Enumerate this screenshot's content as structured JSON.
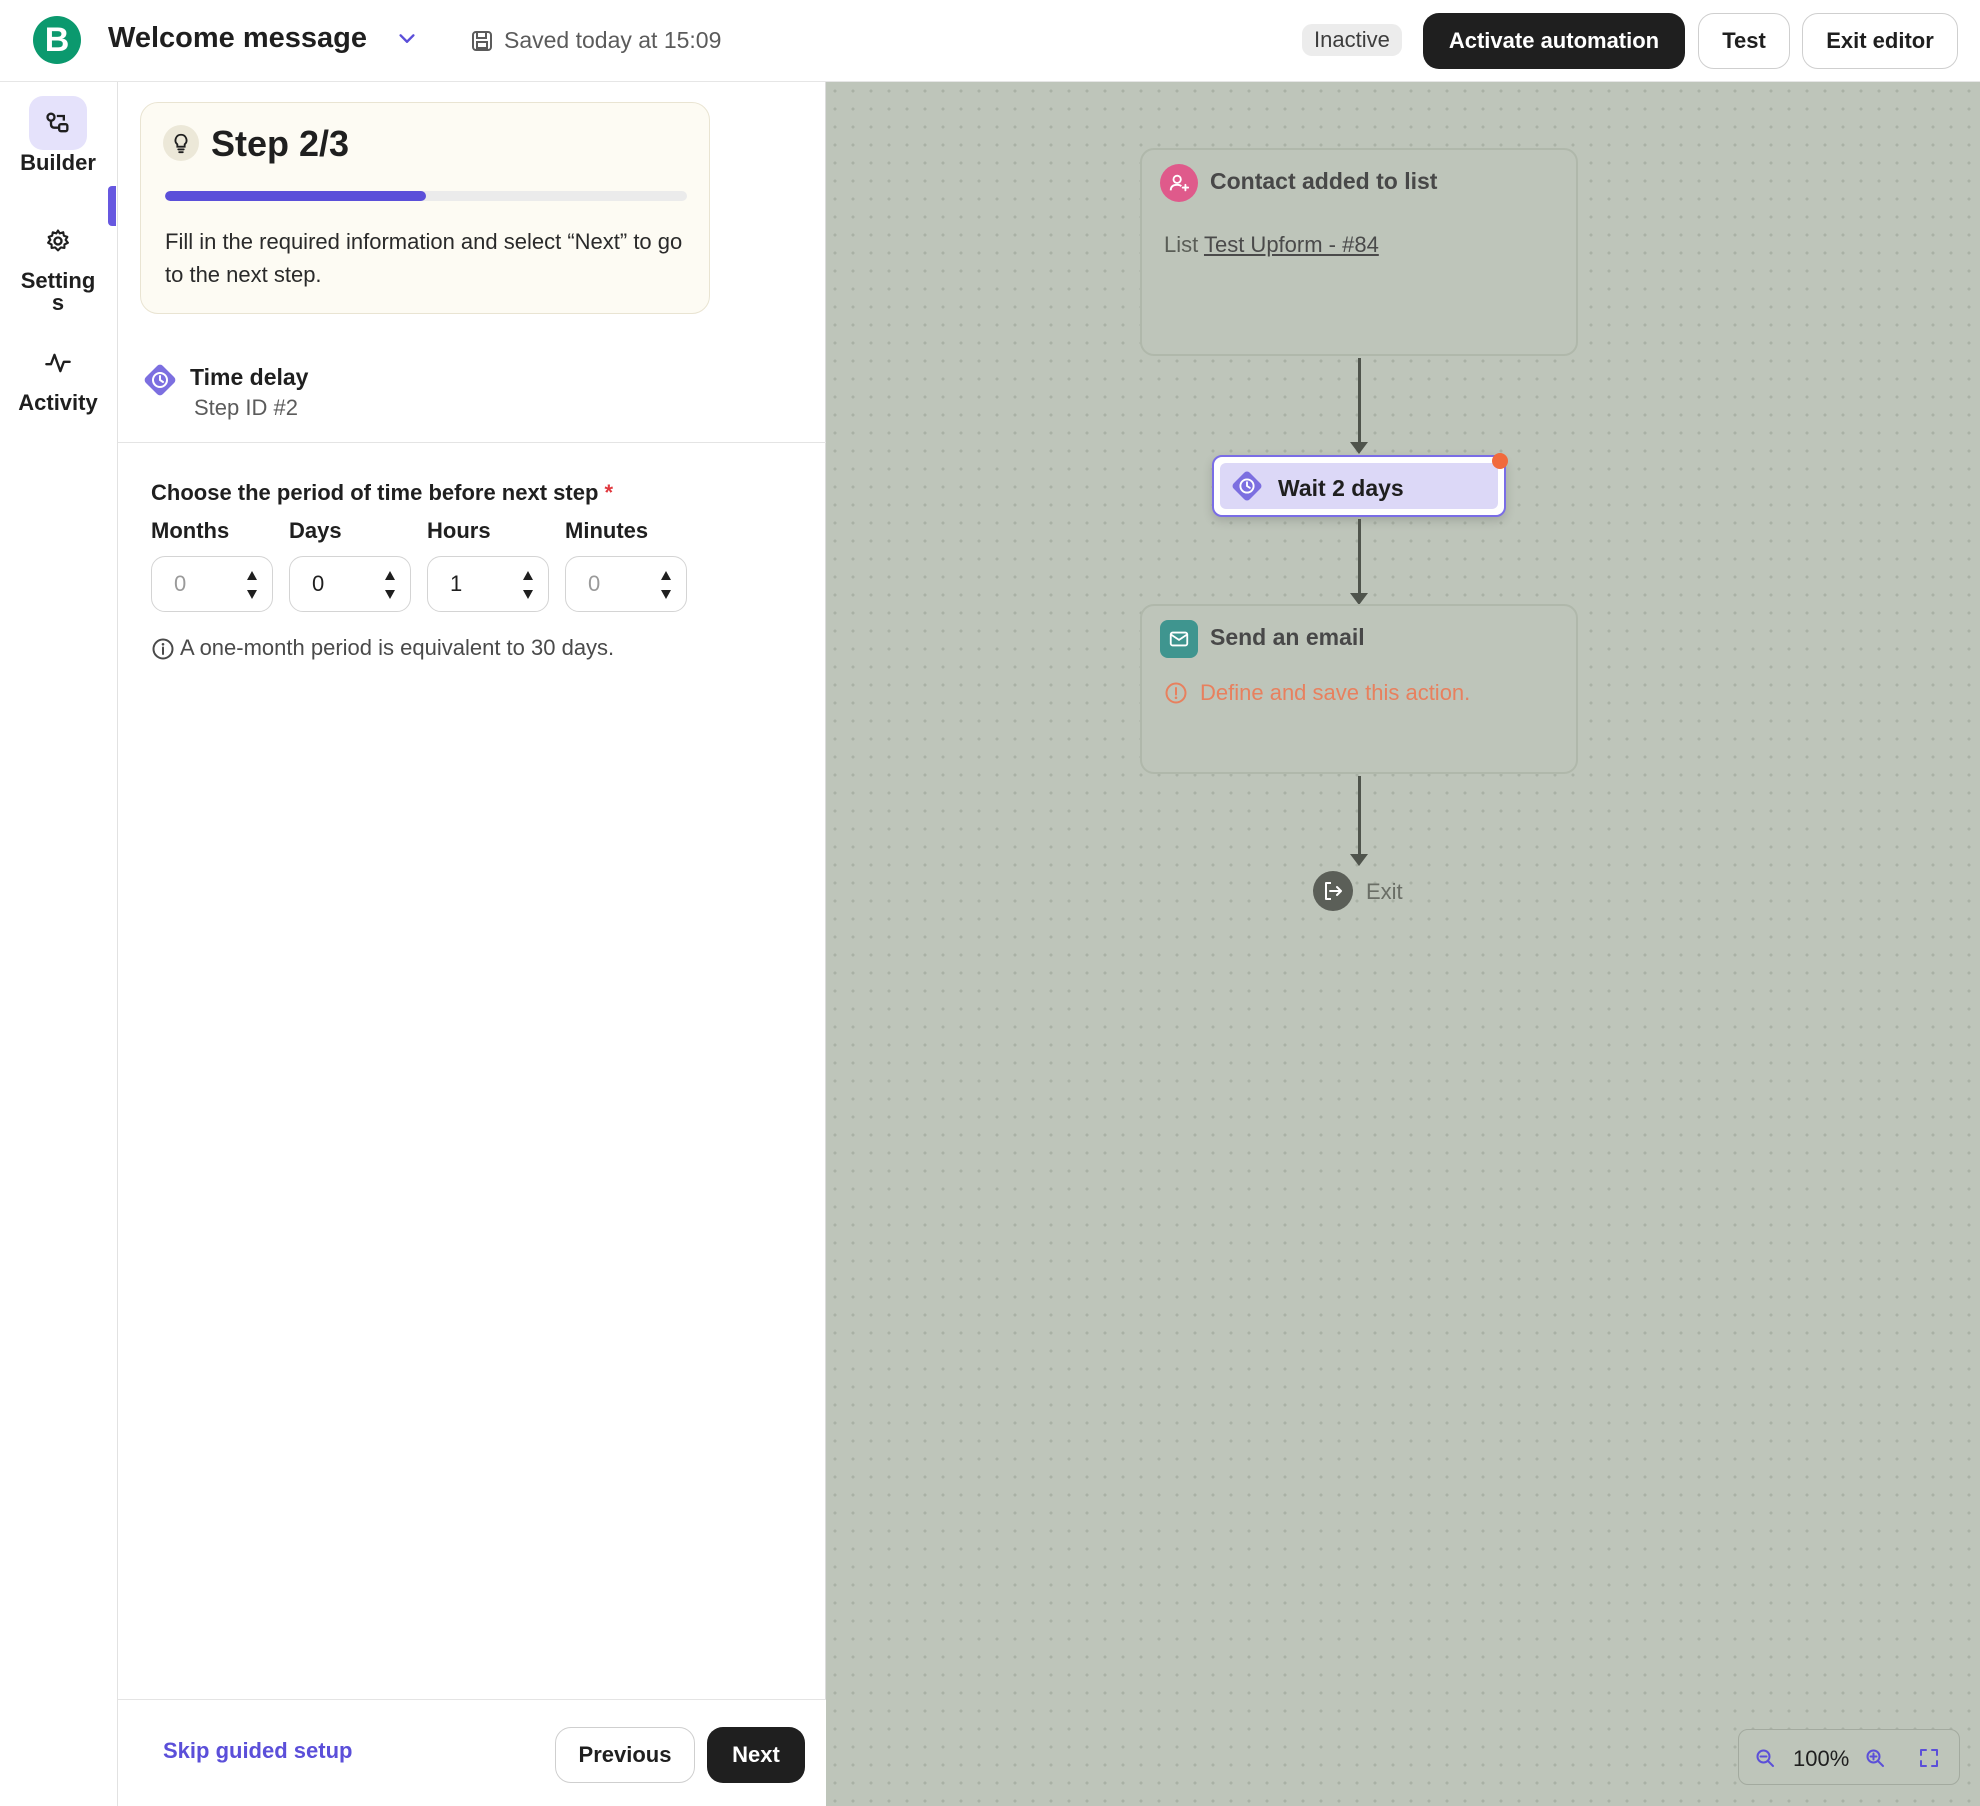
{
  "app": {
    "logo_letter": "B",
    "title": "Welcome message",
    "saved_status": "Saved today at 15:09",
    "status_badge": "Inactive",
    "activate_label": "Activate automation",
    "test_label": "Test",
    "exit_label": "Exit editor"
  },
  "nav": {
    "items": [
      {
        "label": "Builder",
        "icon": "builder-icon",
        "active": true
      },
      {
        "label": "Settings",
        "icon": "gear-icon",
        "active": false
      },
      {
        "label": "Activity",
        "icon": "activity-icon",
        "active": false
      }
    ]
  },
  "guide": {
    "step_title": "Step 2/3",
    "progress": 0.5,
    "description": "Fill in the required information and select “Next” to go to the next step."
  },
  "step": {
    "title": "Time delay",
    "subtitle": "Step ID #2"
  },
  "period": {
    "label": "Choose the period of time before next step",
    "required_mark": "*",
    "fields": [
      {
        "label": "Months",
        "value": "0",
        "placeholder": true
      },
      {
        "label": "Days",
        "value": "0",
        "placeholder": false
      },
      {
        "label": "Hours",
        "value": "1",
        "placeholder": false
      },
      {
        "label": "Minutes",
        "value": "0",
        "placeholder": true
      }
    ],
    "hint": "A one-month period is equivalent to 30 days."
  },
  "footer": {
    "skip_label": "Skip guided setup",
    "previous_label": "Previous",
    "next_label": "Next"
  },
  "canvas": {
    "trigger": {
      "title": "Contact added to list",
      "body_prefix": "List",
      "body_link": "Test Upform - #84"
    },
    "wait": {
      "label": "Wait 2 days"
    },
    "email": {
      "title": "Send an email",
      "warning": "Define and save this action."
    },
    "exit_label": "Exit",
    "zoom_level": "100%"
  },
  "colors": {
    "accent": "#5b4fd9",
    "brand": "#0b996e",
    "warning": "#e8805e",
    "canvas_bg": "#bec5ba"
  }
}
